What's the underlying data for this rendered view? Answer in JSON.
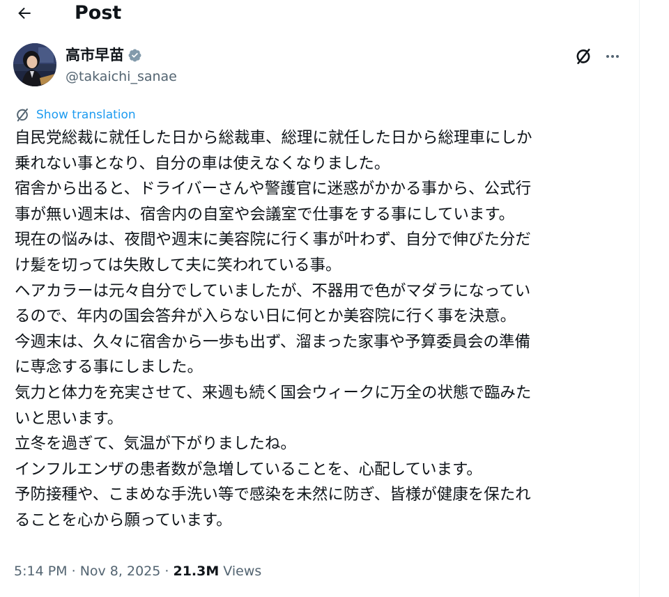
{
  "header": {
    "title": "Post",
    "back_icon": "arrow-left-icon"
  },
  "author": {
    "name": "高市早苗",
    "handle": "@takaichi_sanae",
    "verified_color": "#829aab"
  },
  "actions": {
    "grok_icon": "grok-icon",
    "more_icon": "more-horizontal-icon"
  },
  "translation": {
    "label": "Show translation",
    "icon": "grok-icon",
    "color": "#1d9bf0"
  },
  "tweet": {
    "lines": [
      "自民党総裁に就任した日から総裁車、総理に就任した日から総理車にしか",
      "乗れない事となり、自分の車は使えなくなりました。",
      "宿舎から出ると、ドライバーさんや警護官に迷惑がかかる事から、公式行",
      "事が無い週末は、宿舎内の自室や会議室で仕事をする事にしています。",
      "現在の悩みは、夜間や週末に美容院に行く事が叶わず、自分で伸びた分だ",
      "け髪を切っては失敗して夫に笑われている事。",
      "ヘアカラーは元々自分でしていましたが、不器用で色がマダラになってい",
      "るので、年内の国会答弁が入らない日に何とか美容院に行く事を決意。",
      "今週末は、久々に宿舎から一歩も出ず、溜まった家事や予算委員会の準備",
      "に専念する事にしました。",
      "気力と体力を充実させて、来週も続く国会ウィークに万全の状態で臨みた",
      "いと思います。",
      "立冬を過ぎて、気温が下がりましたね。",
      "インフルエンザの患者数が急増していることを、心配しています。",
      "予防接種や、こまめな手洗い等で感染を未然に防ぎ、皆様が健康を保たれ",
      "ることを心から願っています。"
    ]
  },
  "meta": {
    "time": "5:14 PM",
    "date": "Nov 8, 2025",
    "separator": " · ",
    "views_count": "21.3M",
    "views_label": " Views"
  }
}
